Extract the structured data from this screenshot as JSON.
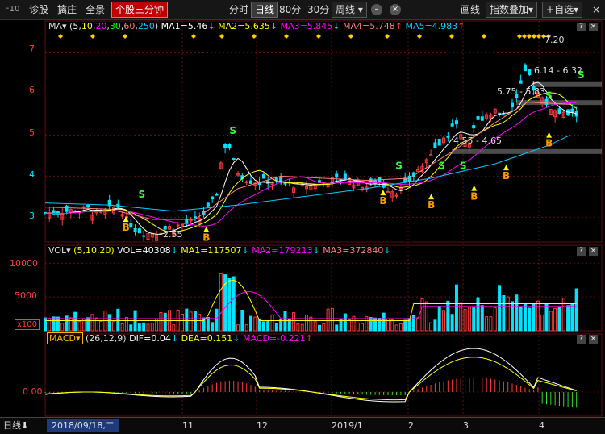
{
  "toolbar": {
    "f10": "F10",
    "diag": "诊股",
    "pull": "擒庄",
    "full": "全景",
    "tri": "个股三分钟",
    "tabs": [
      "分时",
      "日线",
      "80分",
      "30分"
    ],
    "period": "周线",
    "line": "画线",
    "index_overlay": "指数叠加",
    "watchlist": "自选",
    "close": "×",
    "minimize": "–",
    "plus": "+"
  },
  "colors": {
    "up": "#ff3b3b",
    "down": "#00e5ff",
    "ma5": "#ffffff",
    "ma10": "#ffff00",
    "ma20": "#ff00ff",
    "ma30": "#00ff00",
    "ma60": "#ff7f7f",
    "ma250": "#00ccff",
    "grid": "#5a1010"
  },
  "price_panel": {
    "label": "MA",
    "params_prefix": "(",
    "params_suffix": ")",
    "params": [
      "5",
      "10",
      "20",
      "30",
      "60",
      "250"
    ],
    "ma": [
      {
        "label": "MA1=5.46",
        "arrow": "↓"
      },
      {
        "label": "MA2=5.635",
        "arrow": "↓"
      },
      {
        "label": "MA3=5.845",
        "arrow": "↓"
      },
      {
        "label": "MA4=5.748",
        "arrow": "↑"
      },
      {
        "label": "MA5=4.983",
        "arrow": "↑"
      }
    ],
    "y_ticks": [
      "7",
      "6",
      "5",
      "4",
      "3"
    ],
    "annotations": {
      "high": "7.20",
      "low": "2.55",
      "range1": "6.14 - 6.32",
      "range2": "5.75 - 5.83",
      "range3": "4.55 - 4.65"
    },
    "buy": "B",
    "sell": "S"
  },
  "volume_panel": {
    "label": "VOL",
    "params": "(5,10,20)",
    "items": [
      {
        "label": "VOL=40308",
        "arrow": "↓"
      },
      {
        "label": "MA1=117507",
        "arrow": "↓"
      },
      {
        "label": "MA2=179213",
        "arrow": "↓"
      },
      {
        "label": "MA3=372840",
        "arrow": "↓"
      }
    ],
    "y_ticks": [
      "10000",
      "5000"
    ],
    "unit": "x100"
  },
  "macd_panel": {
    "label": "MACD",
    "params": "(26,12,9)",
    "items": [
      {
        "label": "DIF=0.04",
        "arrow": "↓"
      },
      {
        "label": "DEA=0.151",
        "arrow": "↓"
      },
      {
        "label": "MACD=-0.221",
        "arrow": "↑"
      }
    ],
    "y_ticks": [
      "0.00"
    ]
  },
  "bottom": {
    "period": "日线",
    "date": "2018/09/18,二",
    "months": [
      "11",
      "12",
      "2019/1",
      "2",
      "3",
      "4"
    ]
  },
  "panel_buttons": {
    "help": "?",
    "close": "×"
  },
  "chart_data": {
    "type": "candlestick",
    "date_range": [
      "2018/09/18",
      "2019/04"
    ],
    "price_range": [
      2.55,
      7.2
    ],
    "ylim": [
      2.4,
      7.5
    ],
    "y_ticks": [
      3,
      4,
      5,
      6,
      7
    ],
    "x_months": [
      "11",
      "12",
      "2019/1",
      "2",
      "3",
      "4"
    ],
    "close_path": [
      [
        0,
        3.1
      ],
      [
        20,
        3.15
      ],
      [
        40,
        3.2
      ],
      [
        50,
        3.05
      ],
      [
        60,
        3.2
      ],
      [
        70,
        3.3
      ],
      [
        75,
        2.95
      ],
      [
        85,
        2.7
      ],
      [
        95,
        2.6
      ],
      [
        105,
        2.65
      ],
      [
        115,
        2.75
      ],
      [
        125,
        2.8
      ],
      [
        135,
        2.85
      ],
      [
        145,
        3.0
      ],
      [
        155,
        3.3
      ],
      [
        160,
        3.6
      ],
      [
        165,
        4.5
      ],
      [
        170,
        4.9
      ],
      [
        175,
        4.4
      ],
      [
        180,
        4.1
      ],
      [
        190,
        3.9
      ],
      [
        200,
        3.85
      ],
      [
        210,
        3.9
      ],
      [
        220,
        3.8
      ],
      [
        230,
        3.8
      ],
      [
        240,
        3.75
      ],
      [
        250,
        3.8
      ],
      [
        260,
        3.85
      ],
      [
        270,
        3.9
      ],
      [
        280,
        3.95
      ],
      [
        290,
        3.85
      ],
      [
        300,
        3.75
      ],
      [
        310,
        3.9
      ],
      [
        320,
        3.7
      ],
      [
        330,
        3.6
      ],
      [
        340,
        3.9
      ],
      [
        350,
        4.2
      ],
      [
        360,
        4.5
      ],
      [
        365,
        4.7
      ],
      [
        375,
        5.0
      ],
      [
        385,
        5.3
      ],
      [
        390,
        4.9
      ],
      [
        395,
        4.7
      ],
      [
        400,
        5.2
      ],
      [
        410,
        5.5
      ],
      [
        420,
        5.6
      ],
      [
        430,
        5.5
      ],
      [
        440,
        5.9
      ],
      [
        445,
        6.3
      ],
      [
        450,
        6.6
      ],
      [
        455,
        6.2
      ],
      [
        460,
        6.0
      ],
      [
        470,
        5.7
      ],
      [
        480,
        5.5
      ],
      [
        490,
        5.5
      ]
    ],
    "ma250_path": [
      [
        0,
        3.35
      ],
      [
        60,
        3.3
      ],
      [
        120,
        3.15
      ],
      [
        180,
        3.3
      ],
      [
        240,
        3.5
      ],
      [
        300,
        3.7
      ],
      [
        360,
        3.95
      ],
      [
        420,
        4.3
      ],
      [
        470,
        4.75
      ],
      [
        490,
        5.0
      ]
    ],
    "ma_slow_path": [
      [
        0,
        3.25
      ],
      [
        60,
        3.2
      ],
      [
        100,
        2.95
      ],
      [
        140,
        2.95
      ],
      [
        180,
        3.7
      ],
      [
        220,
        4.0
      ],
      [
        260,
        3.95
      ],
      [
        300,
        3.9
      ],
      [
        340,
        3.95
      ],
      [
        380,
        4.6
      ],
      [
        420,
        5.3
      ],
      [
        450,
        5.8
      ],
      [
        490,
        5.75
      ]
    ],
    "buy_signals": [
      [
        75,
        2.95
      ],
      [
        150,
        2.7
      ],
      [
        315,
        3.6
      ],
      [
        360,
        3.5
      ],
      [
        400,
        3.7
      ],
      [
        430,
        4.2
      ],
      [
        470,
        5.0
      ]
    ],
    "sell_signals": [
      [
        90,
        3.4
      ],
      [
        175,
        4.95
      ],
      [
        330,
        4.1
      ],
      [
        370,
        4.1
      ],
      [
        390,
        4.1
      ],
      [
        470,
        5.8
      ],
      [
        500,
        6.3
      ]
    ],
    "volume": {
      "ylim": [
        0,
        11000
      ],
      "y_ticks": [
        5000,
        10000
      ],
      "last": 40308,
      "ma5": 117507,
      "ma10": 179213,
      "ma20": 372840
    },
    "macd": {
      "DIF": 0.04,
      "DEA": 0.151,
      "MACD": -0.221,
      "params": [
        26,
        12,
        9
      ]
    }
  }
}
